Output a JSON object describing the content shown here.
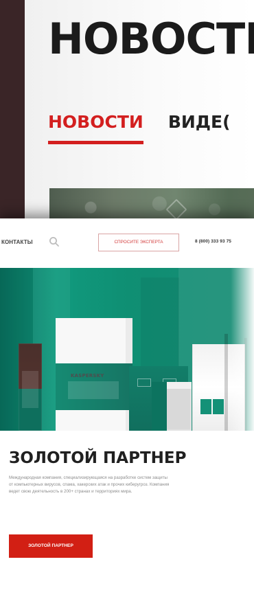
{
  "top_card": {
    "title": "НОВОСТИ",
    "tabs": [
      {
        "label": "НОВОСТИ",
        "active": true
      },
      {
        "label": "ВИДЕ(",
        "active": false
      }
    ],
    "accent_color": "#d31f1f"
  },
  "site": {
    "header": {
      "contacts": "КОНТАКТЫ",
      "search_icon": "search-icon",
      "cta": "СПРОСИТЕ ЭКСПЕРТА",
      "phone": "8 (800) 333 93 75"
    },
    "hero": {
      "brand_logo": "KASPERSKY"
    },
    "partner": {
      "title": "ЗОЛОТОЙ ПАРТНЕР",
      "lines": [
        "Международная компания, специализирующаяся на разработке систем защиты",
        "от компьютерных вирусов, спама, хакерских атак и прочих киберугроз. Компания",
        "ведет свою деятельность в 200+ странах и территориях мира."
      ],
      "button": "ЗОЛОТОЙ ПАРТНЕР"
    },
    "colors": {
      "hero_green": "#0f8f73",
      "button_red": "#d21f14"
    }
  }
}
